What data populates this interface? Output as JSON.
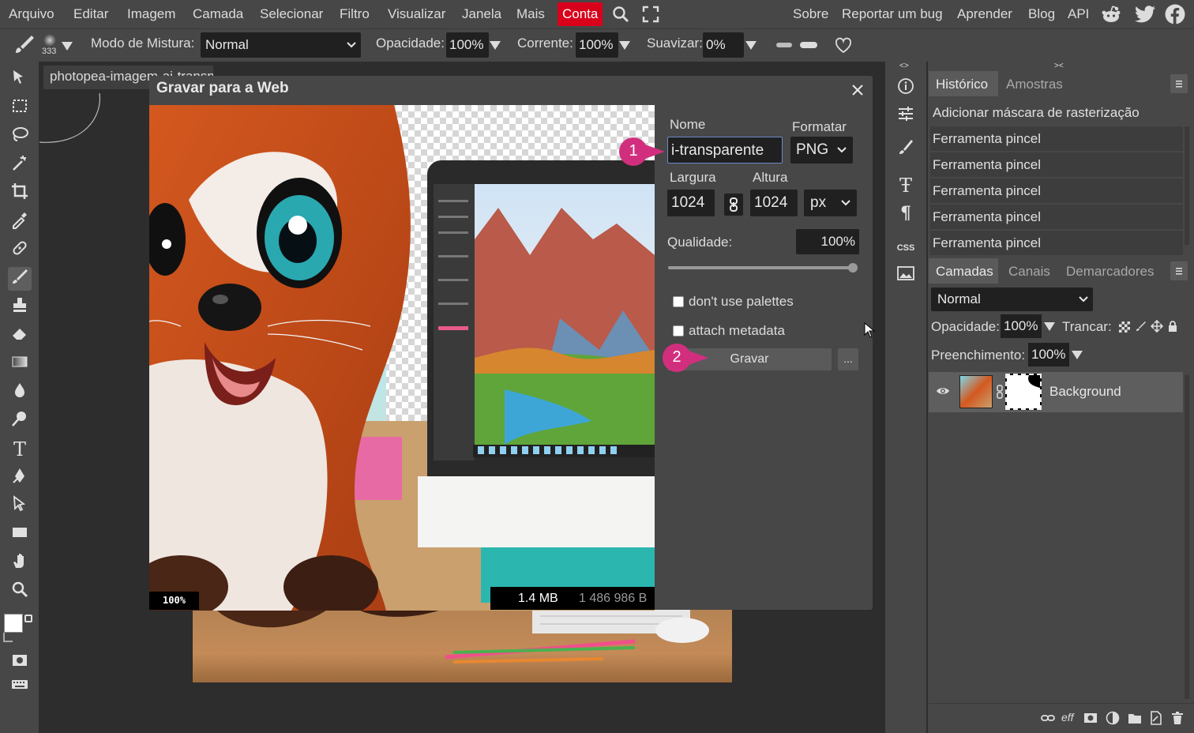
{
  "menu": {
    "items": [
      "Arquivo",
      "Editar",
      "Imagem",
      "Camada",
      "Selecionar",
      "Filtro",
      "Visualizar",
      "Janela",
      "Mais"
    ],
    "account": "Conta",
    "right_items": [
      "Sobre",
      "Reportar um bug",
      "Aprender",
      "Blog",
      "API"
    ]
  },
  "options": {
    "brush_size": "333",
    "blend_label": "Modo de Mistura:",
    "blend_value": "Normal",
    "opacity_label": "Opacidade:",
    "opacity_value": "100%",
    "flow_label": "Corrente:",
    "flow_value": "100%",
    "smooth_label": "Suavizar:",
    "smooth_value": "0%"
  },
  "document": {
    "tab_title": "photopea-imagem-ai-transparente"
  },
  "dialog": {
    "title": "Gravar para a Web",
    "name_label": "Nome",
    "name_value": "i-transparente",
    "format_label": "Formatar",
    "format_value": "PNG",
    "width_label": "Largura",
    "width_value": "1024",
    "height_label": "Altura",
    "height_value": "1024",
    "unit_value": "px",
    "quality_label": "Qualidade:",
    "quality_value": "100%",
    "quality_level": 1.0,
    "option_palettes": "don't use palettes",
    "option_metadata": "attach metadata",
    "save_button": "Gravar",
    "more_button": "...",
    "zoom": "100%",
    "size_short": "1.4 MB",
    "size_bytes": "1 486 986 B",
    "callout_1": "1",
    "callout_2": "2",
    "callout_color": "#d12f7e"
  },
  "history_panel": {
    "tab_active": "Histórico",
    "tab_other": "Amostras",
    "entries": [
      "Adicionar máscara de rasterização",
      "Ferramenta pincel",
      "Ferramenta pincel",
      "Ferramenta pincel",
      "Ferramenta pincel",
      "Ferramenta pincel"
    ]
  },
  "layers_panel": {
    "tabs": [
      "Camadas",
      "Canais",
      "Demarcadores"
    ],
    "blend_value": "Normal",
    "opacity_label": "Opacidade:",
    "opacity_value": "100%",
    "lock_label": "Trancar:",
    "fill_label": "Preenchimento:",
    "fill_value": "100%",
    "layer_name": "Background",
    "footer_eff": "eff"
  },
  "right_column": {
    "css_label": "CSS"
  },
  "colors": {
    "accent_red": "#d9001b",
    "panel_bg": "#474747",
    "field_bg": "#202020"
  }
}
